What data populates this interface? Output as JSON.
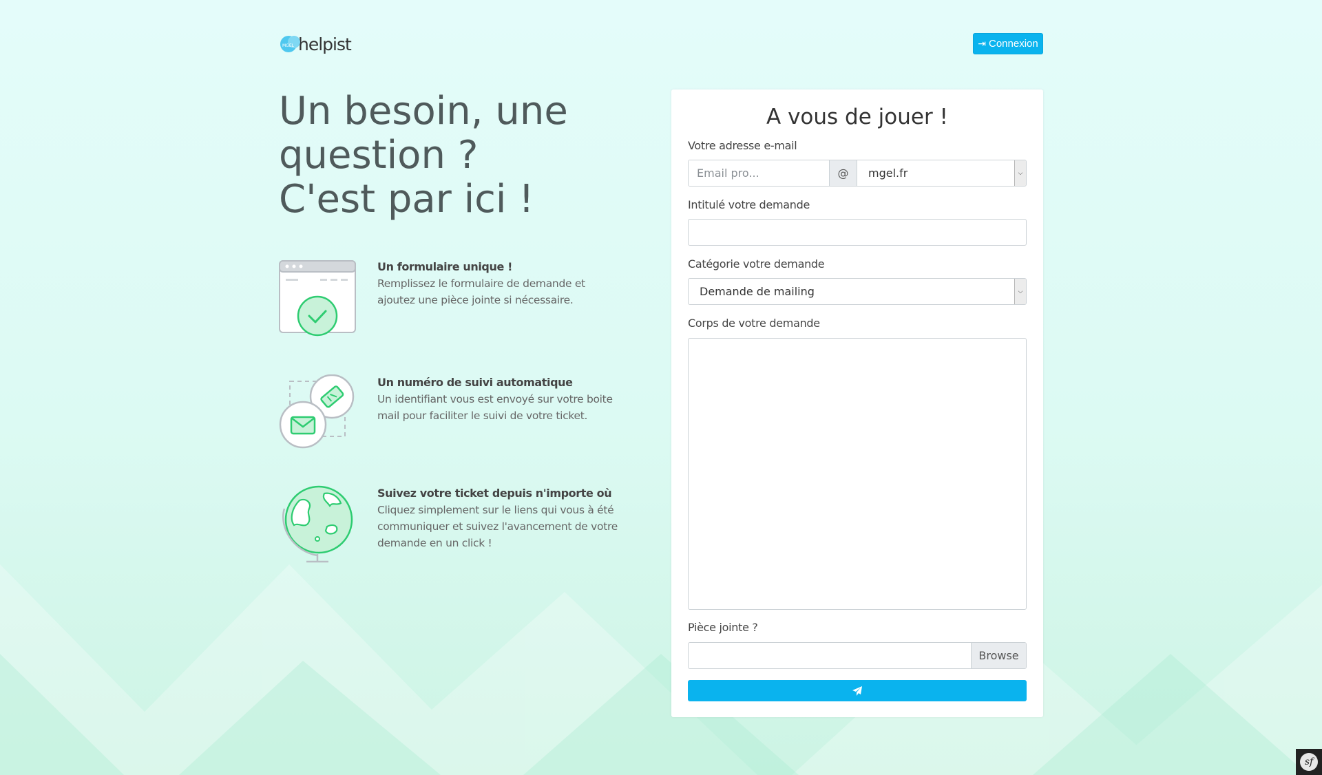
{
  "header": {
    "logo_text": "helpist",
    "logo_badge": "MGEL",
    "login_label": "Connexion",
    "login_icon": "sign-in-icon"
  },
  "hero": {
    "title_lines": [
      "Un besoin, une",
      "question ?",
      "C'est par ici !"
    ]
  },
  "features": [
    {
      "icon": "form-check-icon",
      "title": "Un formulaire unique !",
      "desc_lines": [
        "Remplissez le formulaire de demande et",
        "ajoutez une pièce jointe si nécessaire."
      ]
    },
    {
      "icon": "ticket-mail-icon",
      "title": "Un numéro de suivi automatique",
      "desc_lines": [
        "Un identifiant vous est envoyé sur votre boite",
        "mail pour faciliter le suivi de votre ticket."
      ]
    },
    {
      "icon": "globe-icon",
      "title": "Suivez votre ticket depuis n'importe où",
      "desc_lines": [
        "Cliquez simplement sur le liens qui vous à été",
        "communiquer et suivez l'avancement de votre",
        "demande en un click !"
      ]
    }
  ],
  "form": {
    "title": "A vous de jouer !",
    "email_label": "Votre adresse e-mail",
    "email_placeholder": "Email pro...",
    "email_value": "",
    "at_sign": "@",
    "domain_selected": "mgel.fr",
    "subject_label": "Intitulé votre demande",
    "subject_value": "",
    "category_label": "Catégorie votre demande",
    "category_selected": "Demande de mailing",
    "body_label": "Corps de votre demande",
    "body_value": "",
    "attachment_label": "Pièce jointe ?",
    "browse_label": "Browse",
    "submit_icon": "paper-plane-icon"
  },
  "colors": {
    "accent": "#0ab3ee",
    "green": "#2ecc71",
    "title_gray": "#4f5a5b"
  },
  "footer": {
    "symfony_badge": "sf"
  }
}
